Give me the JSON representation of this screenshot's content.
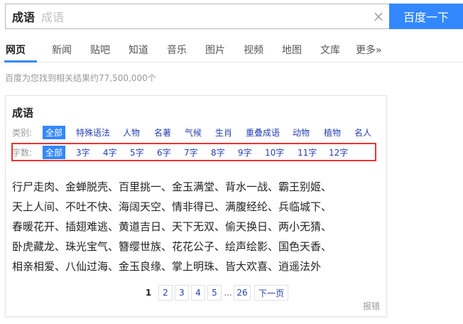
{
  "search": {
    "query": "成语",
    "hint": "成语",
    "clear_glyph": "×",
    "button_label": "百度一下"
  },
  "tabs": [
    {
      "label": "网页"
    },
    {
      "label": "新闻"
    },
    {
      "label": "贴吧"
    },
    {
      "label": "知道"
    },
    {
      "label": "音乐"
    },
    {
      "label": "图片"
    },
    {
      "label": "视频"
    },
    {
      "label": "地图"
    },
    {
      "label": "文库"
    },
    {
      "label": "更多»"
    }
  ],
  "result_count": "百度为您找到相关结果约77,500,000个",
  "card": {
    "title": "成语",
    "category_label": "类别:",
    "categories": [
      "全部",
      "特殊语法",
      "人物",
      "名著",
      "气候",
      "生肖",
      "重叠成语",
      "动物",
      "植物",
      "名人"
    ],
    "length_label": "字数:",
    "lengths": [
      "全部",
      "3字",
      "4字",
      "5字",
      "6字",
      "7字",
      "8字",
      "9字",
      "10字",
      "11字",
      "12字"
    ],
    "idiom_lines": [
      "行尸走肉、金蝉脱壳、百里挑一、金玉满堂、背水一战、霸王别姬、",
      "天上人间、不吐不快、海阔天空、情非得已、满腹经纶、兵临城下、",
      "春暖花开、插翅难逃、黄道吉日、天下无双、偷天换日、两小无猜、",
      "卧虎藏龙、珠光宝气、簪缨世族、花花公子、绘声绘影、国色天香、",
      "相亲相爱、八仙过海、金玉良缘、掌上明珠、皆大欢喜、逍遥法外"
    ],
    "pager": {
      "current": "1",
      "pages": [
        "2",
        "3",
        "4",
        "5"
      ],
      "ellipsis": "...",
      "last": "26",
      "next": "下一页"
    },
    "report": "报错"
  },
  "colors": {
    "accent": "#3388ff",
    "link": "#2440b3",
    "highlight_border": "#ee3333"
  }
}
